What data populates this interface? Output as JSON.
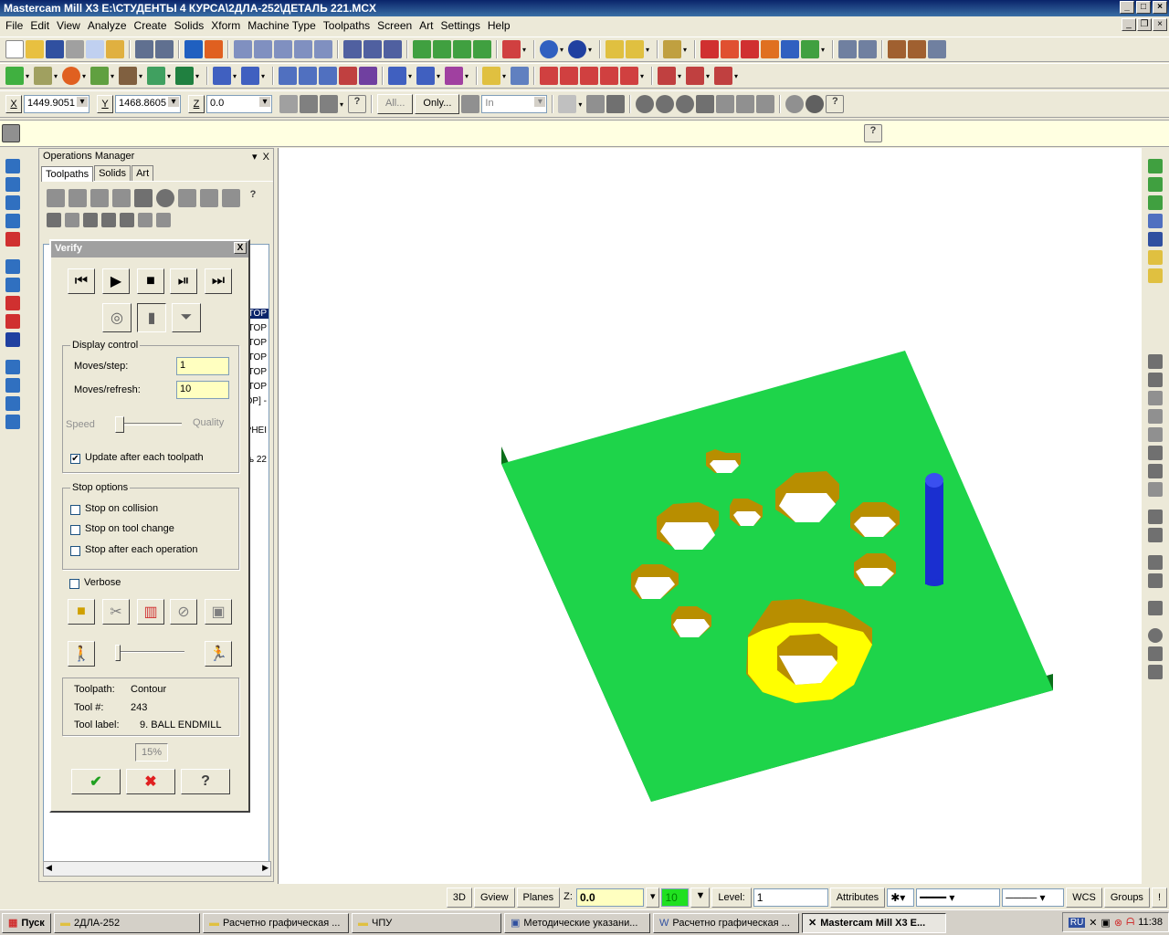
{
  "titlebar": {
    "title": "Mastercam Mill X3  E:\\СТУДЕНТЫ 4 КУРСА\\2ДЛА-252\\ДЕТАЛЬ 221.MCX"
  },
  "menu": [
    "File",
    "Edit",
    "View",
    "Analyze",
    "Create",
    "Solids",
    "Xform",
    "Machine Type",
    "Toolpaths",
    "Screen",
    "Art",
    "Settings",
    "Help"
  ],
  "coords": {
    "x_label": "X",
    "x_value": "1449.9051",
    "y_label": "Y",
    "y_value": "1468.8605",
    "z_label": "Z",
    "z_value": "0.0"
  },
  "selection": {
    "all_label": "All...",
    "only_label": "Only...",
    "mode_value": "In"
  },
  "ops_manager": {
    "title": "Operations Manager",
    "close": "X",
    "tabs": [
      "Toolpaths",
      "Solids",
      "Art"
    ],
    "rows": [
      "TOP",
      "TOP",
      "TOP",
      "TOP",
      "TOP",
      "TOP",
      "OP] -",
      "PHEI",
      "ль 22"
    ]
  },
  "verify": {
    "title": "Verify",
    "close": "X",
    "display_control": {
      "legend": "Display control",
      "moves_step_label": "Moves/step:",
      "moves_step_value": "1",
      "moves_refresh_label": "Moves/refresh:",
      "moves_refresh_value": "10",
      "speed_label": "Speed",
      "quality_label": "Quality",
      "speed_quality_level": 0.05,
      "update_label": "Update after each toolpath",
      "update_checked": true
    },
    "stop_options": {
      "legend": "Stop options",
      "collision": "Stop on collision",
      "tool_change": "Stop on tool change",
      "each_op": "Stop after each operation"
    },
    "verbose": "Verbose",
    "info": {
      "toolpath_label": "Toolpath:",
      "toolpath_value": "Contour",
      "toolnum_label": "Tool #:",
      "toolnum_value": "243",
      "toollabel_label": "Tool label:",
      "toollabel_value": "9. BALL ENDMILL"
    },
    "progress": "15%"
  },
  "status": {
    "view3d": "3D",
    "gview": "Gview",
    "planes": "Planes",
    "z_label": "Z:",
    "z_value": "0.0",
    "color_value": "10",
    "level_label": "Level:",
    "level_value": "1",
    "attributes": "Attributes",
    "wcs": "WCS",
    "groups": "Groups",
    "help": "!"
  },
  "taskbar": {
    "start": "Пуск",
    "tasks": [
      "2ДЛА-252",
      "Расчетно графическая ...",
      "ЧПУ",
      "Методические указани...",
      "Расчетно графическая ...",
      "Mastercam Mill X3  E..."
    ],
    "lang": "RU",
    "clock": "11:38"
  },
  "colors": {
    "stock_top": "#1ed44a",
    "stock_side": "#0a6e1a",
    "hole_wall": "#b88e00",
    "tool": "#1a2fd0",
    "highlight": "#ffff00"
  }
}
